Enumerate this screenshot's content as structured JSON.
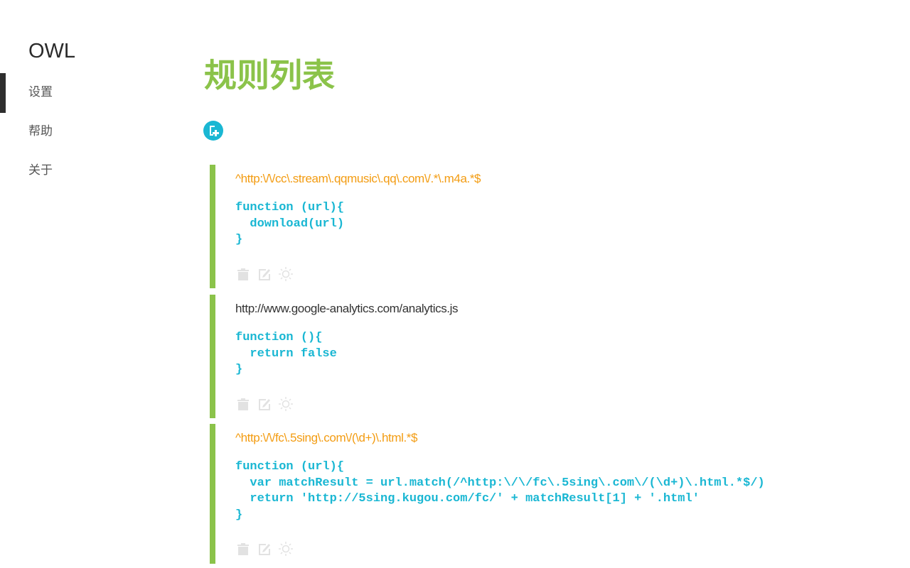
{
  "app": {
    "logo": "OWL"
  },
  "sidebar": {
    "items": [
      {
        "label": "设置",
        "active": true
      },
      {
        "label": "帮助",
        "active": false
      },
      {
        "label": "关于",
        "active": false
      }
    ]
  },
  "main": {
    "title": "规则列表",
    "add_button": {
      "icon": "add-document-icon"
    },
    "colors": {
      "accent_green": "#8bc34a",
      "code_cyan": "#1ab7d3",
      "regex_orange": "#f39c12"
    },
    "rules": [
      {
        "pattern": "^http:\\/\\/cc\\.stream\\.qqmusic\\.qq\\.com\\/.*\\.m4a.*$",
        "is_regex": true,
        "code": "function (url){\n  download(url)\n}",
        "actions": [
          "trash-icon",
          "edit-icon",
          "toggle-sun-icon"
        ]
      },
      {
        "pattern": "http://www.google-analytics.com/analytics.js",
        "is_regex": false,
        "code": "function (){\n  return false\n}",
        "actions": [
          "trash-icon",
          "edit-icon",
          "toggle-sun-icon"
        ]
      },
      {
        "pattern": "^http:\\/\\/fc\\.5sing\\.com\\/(\\d+)\\.html.*$",
        "is_regex": true,
        "code": "function (url){\n  var matchResult = url.match(/^http:\\/\\/fc\\.5sing\\.com\\/(\\d+)\\.html.*$/)\n  return 'http://5sing.kugou.com/fc/' + matchResult[1] + '.html'\n}",
        "actions": [
          "trash-icon",
          "edit-icon",
          "toggle-sun-icon"
        ]
      }
    ]
  }
}
